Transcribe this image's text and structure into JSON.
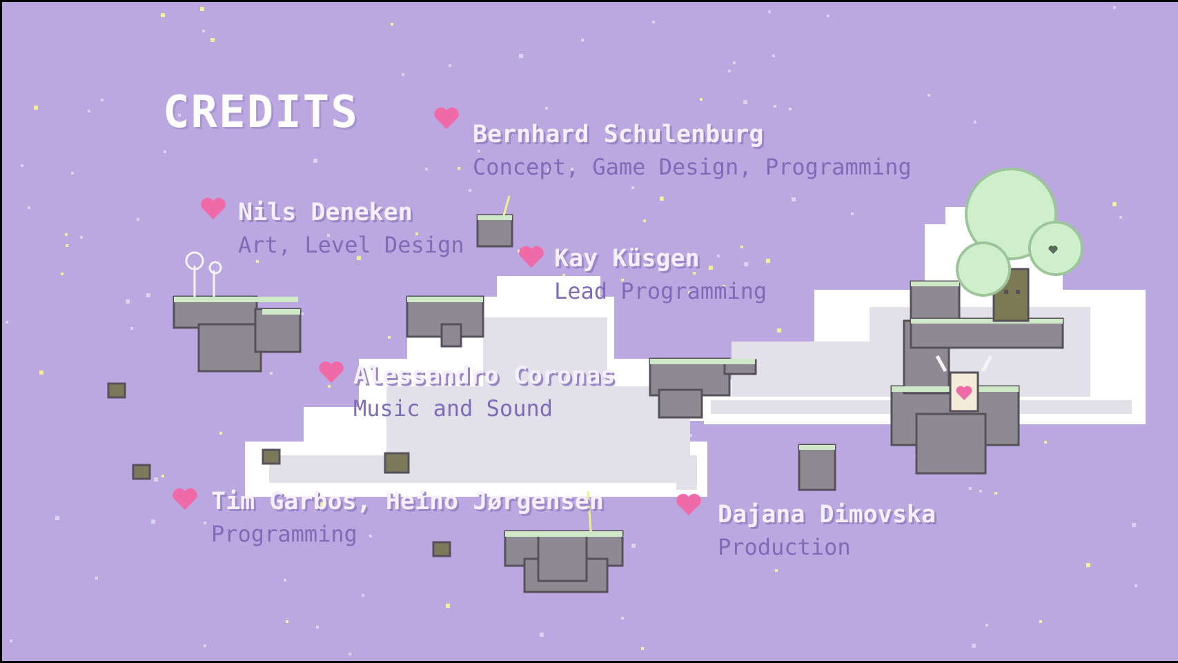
{
  "screen": {
    "title": "CREDITS"
  },
  "credits": [
    {
      "name": "Bernhard Schulenburg",
      "role": "Concept, Game Design, Programming"
    },
    {
      "name": "Nils Deneken",
      "role": "Art, Level Design"
    },
    {
      "name": "Kay Küsgen",
      "role": "Lead Programming"
    },
    {
      "name": "Alessandro Coronas",
      "role": "Music and Sound"
    },
    {
      "name": "Tim Garbos, Heino Jørgensen",
      "role": "Programming"
    },
    {
      "name": "Dajana Dimovska",
      "role": "Production"
    }
  ],
  "palette": {
    "sky": "#bca8e0",
    "heart": "#f06aa8",
    "cloud": "#ffffff",
    "cloud_shade": "#e2e0e8",
    "rock": "#8f8a92",
    "rock_edge": "#55505a",
    "moss": "#cfe9c8",
    "tree_canopy": "#cfeecb",
    "star": "#f3ee9a"
  },
  "icons": [
    "heart-icon",
    "star-icon",
    "floating-island",
    "tree-spirit",
    "horned-character"
  ]
}
